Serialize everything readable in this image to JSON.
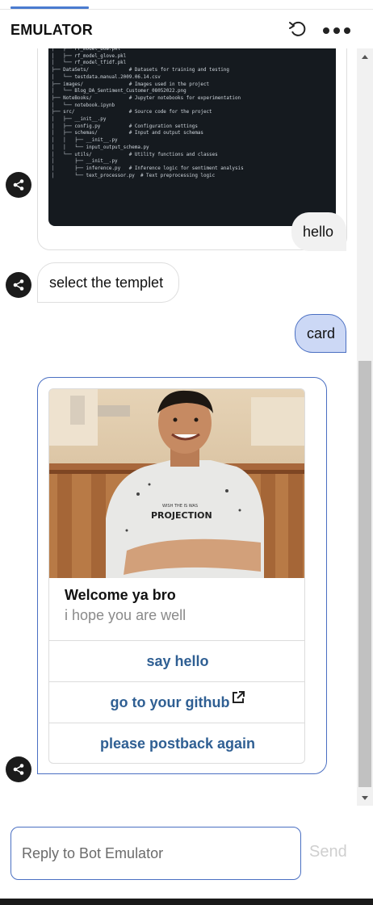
{
  "header": {
    "title": "EMULATOR",
    "restart_icon": "restart-icon",
    "more_icon": "more-horizontal-icon"
  },
  "messages": {
    "code_lines": [
      "│   ├── rf_model_bow.pkl",
      "│   ├── rf_model_glove.pkl",
      "│   └── rf_model_tfidf.pkl",
      "├── DataSets/              # Datasets for training and testing",
      "│   └── testdata.manual.2009.06.14.csv",
      "├── images/                # Images used in the project",
      "│   └── Blog_DA_Sentiment_Customer_08052022.png",
      "├── NoteBooks/             # Jupyter notebooks for experimentation",
      "│   └── notebook.ipynb",
      "├── src/                   # Source code for the project",
      "│   ├── __init__.py",
      "│   ├── config.py          # Configuration settings",
      "│   ├── schemas/           # Input and output schemas",
      "│   │   ├── __init__.py",
      "│   │   └── input_output_schema.py",
      "│   └── utils/             # Utility functions and classes",
      "│       ├── __init__.py",
      "│       ├── inference.py   # Inference logic for sentiment analysis",
      "│       └── text_processor.py  # Text preprocessing logic"
    ],
    "user_1": "hello",
    "bot_1": "select the templet",
    "user_2": "card"
  },
  "card": {
    "title": "Welcome ya bro",
    "subtitle": "i hope you are well",
    "shirt_text_1": "PROJECTION",
    "shirt_text_2": "WISH THE IS WAS",
    "actions": [
      "say hello",
      "go to your github",
      "please postback again"
    ]
  },
  "composer": {
    "placeholder": "Reply to Bot Emulator",
    "send_label": "Send"
  },
  "colors": {
    "accent": "#4a6fc2",
    "link": "#2f5f93",
    "user_highlight_bg": "#ccd8f5"
  }
}
